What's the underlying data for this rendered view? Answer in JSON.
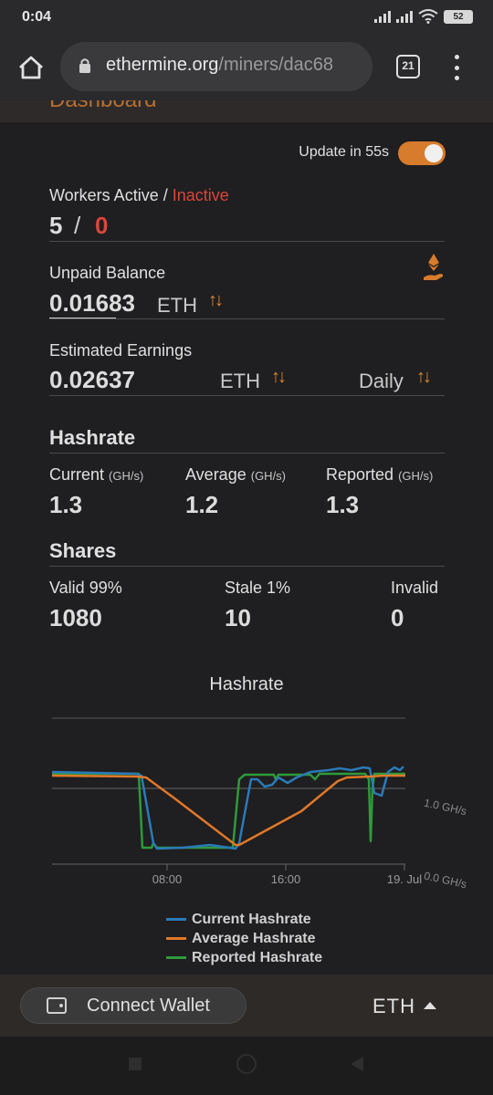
{
  "status": {
    "time": "0:04",
    "battery": "52"
  },
  "browser": {
    "url_host": "ethermine.org",
    "url_path": "/miners/dac68",
    "tab_count": "21"
  },
  "page": {
    "header_title": "Dashboard"
  },
  "update": {
    "label": "Update in 55s",
    "enabled": true
  },
  "workers": {
    "label_active": "Workers Active",
    "separator": " / ",
    "label_inactive": "Inactive",
    "active": "5",
    "slash": "/",
    "inactive": "0"
  },
  "balance": {
    "label": "Unpaid Balance",
    "value": "0.01683",
    "unit": "ETH"
  },
  "earnings": {
    "label": "Estimated Earnings",
    "value": "0.02637",
    "unit": "ETH",
    "period": "Daily"
  },
  "hashrate": {
    "title": "Hashrate",
    "current_label": "Current",
    "current_unit": "(GH/s)",
    "current": "1.3",
    "average_label": "Average",
    "average_unit": "(GH/s)",
    "average": "1.2",
    "reported_label": "Reported",
    "reported_unit": "(GH/s)",
    "reported": "1.3"
  },
  "shares": {
    "title": "Shares",
    "valid_label": "Valid 99%",
    "valid": "1080",
    "stale_label": "Stale 1%",
    "stale": "10",
    "invalid_label": "Invalid",
    "invalid": "0"
  },
  "chart_data": {
    "type": "line",
    "title": "Hashrate",
    "x_ticks": [
      "08:00",
      "16:00",
      "19. Jul"
    ],
    "y_ticks": [
      "0.0 GH/s",
      "1.0 GH/s"
    ],
    "ylim": [
      0,
      1.5
    ],
    "series": [
      {
        "name": "Current Hashrate",
        "color": "#2a7ab8"
      },
      {
        "name": "Average Hashrate",
        "color": "#e0782a"
      },
      {
        "name": "Reported Hashrate",
        "color": "#2e9a3a"
      }
    ]
  },
  "bottom": {
    "wallet_label": "Connect Wallet",
    "currency": "ETH"
  }
}
